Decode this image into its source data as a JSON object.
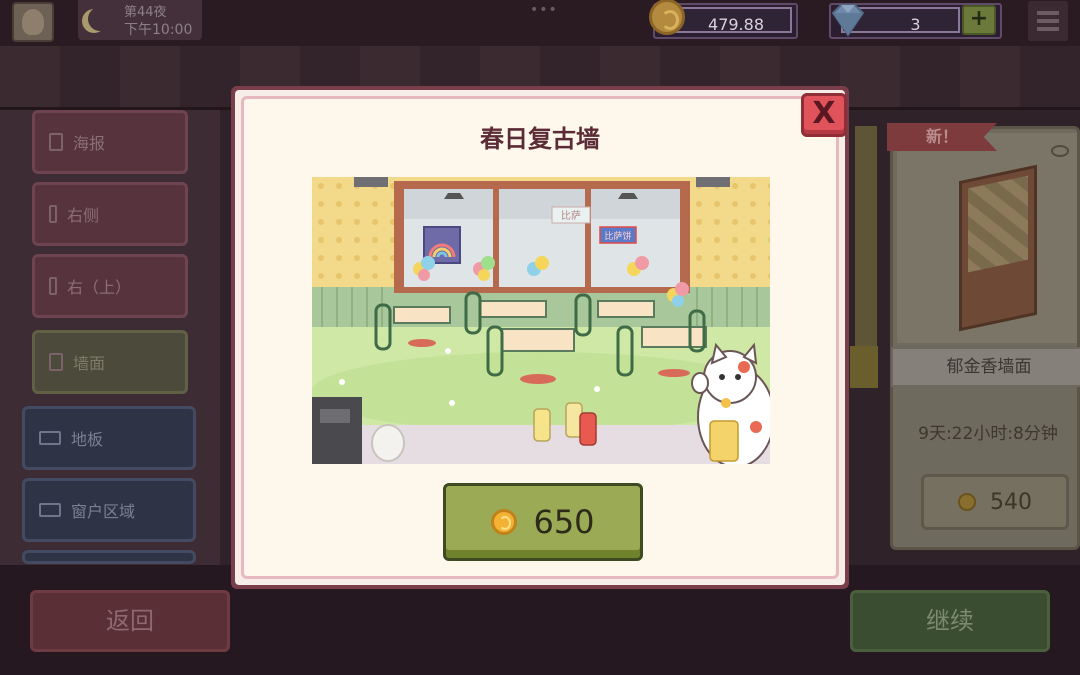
{
  "hud": {
    "night_label": "第44夜",
    "time_label": "下午10:00",
    "coins": "479.88",
    "gems": "3",
    "plus_label": "+"
  },
  "categories": [
    {
      "label": "海报",
      "icon": "poster-icon"
    },
    {
      "label": "右侧",
      "icon": "wall-right-icon"
    },
    {
      "label": "右（上）",
      "icon": "wall-right-top-icon"
    },
    {
      "label": "墙面",
      "icon": "wall-icon"
    },
    {
      "label": "地板",
      "icon": "floor-icon"
    },
    {
      "label": "窗户区域",
      "icon": "window-icon"
    }
  ],
  "shop_card": {
    "badge": "新！",
    "name": "郁金香墙面",
    "timer": "9天:22小时:8分钟",
    "price": "540"
  },
  "bottom": {
    "back_label": "返回",
    "continue_label": "继续"
  },
  "modal": {
    "title": "春日复古墙",
    "close_label": "X",
    "price": "650",
    "preview_signs": [
      "比萨",
      "比萨饼"
    ]
  },
  "colors": {
    "modal_border": "#7a3d4a",
    "modal_bg": "#fdf7ec",
    "buy_button": "#9aaa55",
    "close_button": "#e0535b",
    "title_text": "#5b2b36"
  }
}
